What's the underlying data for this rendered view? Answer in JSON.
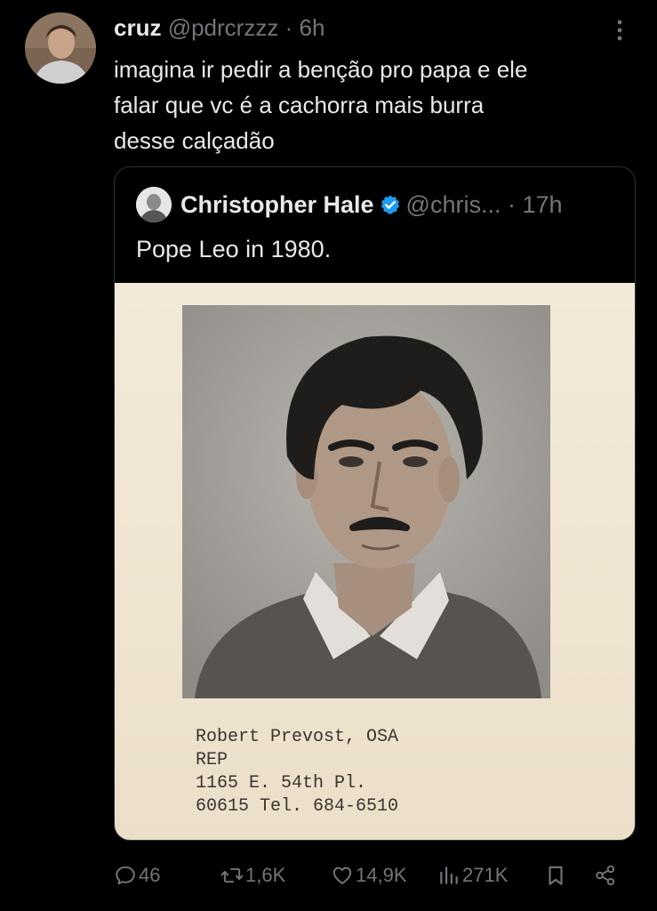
{
  "tweet": {
    "display_name": "cruz",
    "handle": "@pdrcrzzz",
    "separator": "·",
    "time": "6h",
    "text_lines": [
      "imagina ir pedir a benção pro papa e ele",
      "falar que vc é a cachorra mais burra",
      "desse calçadão"
    ],
    "avatar_icon": "profile-photo-icon",
    "more_icon": "more-vertical-icon"
  },
  "quote": {
    "display_name": "Christopher Hale",
    "handle": "@chris...",
    "separator": "·",
    "time": "17h",
    "text": "Pope Leo in 1980.",
    "verified_icon": "verified-badge-icon",
    "verified_color": "#1d9bf0",
    "media": {
      "caption_lines": [
        "Robert Prevost, OSA",
        "REP",
        "1165 E. 54th Pl.",
        "60615 Tel. 684-6510"
      ]
    }
  },
  "actions": {
    "reply": {
      "icon": "reply-icon",
      "count": "46"
    },
    "retweet": {
      "icon": "retweet-icon",
      "count": "1,6K"
    },
    "like": {
      "icon": "heart-icon",
      "count": "14,9K"
    },
    "views": {
      "icon": "views-chart-icon",
      "count": "271K"
    },
    "bookmark": {
      "icon": "bookmark-icon"
    },
    "share": {
      "icon": "share-icon"
    }
  },
  "colors": {
    "background": "#000000",
    "primary_text": "#e7e9ea",
    "secondary_text": "#71767b",
    "border": "#2f3336"
  }
}
